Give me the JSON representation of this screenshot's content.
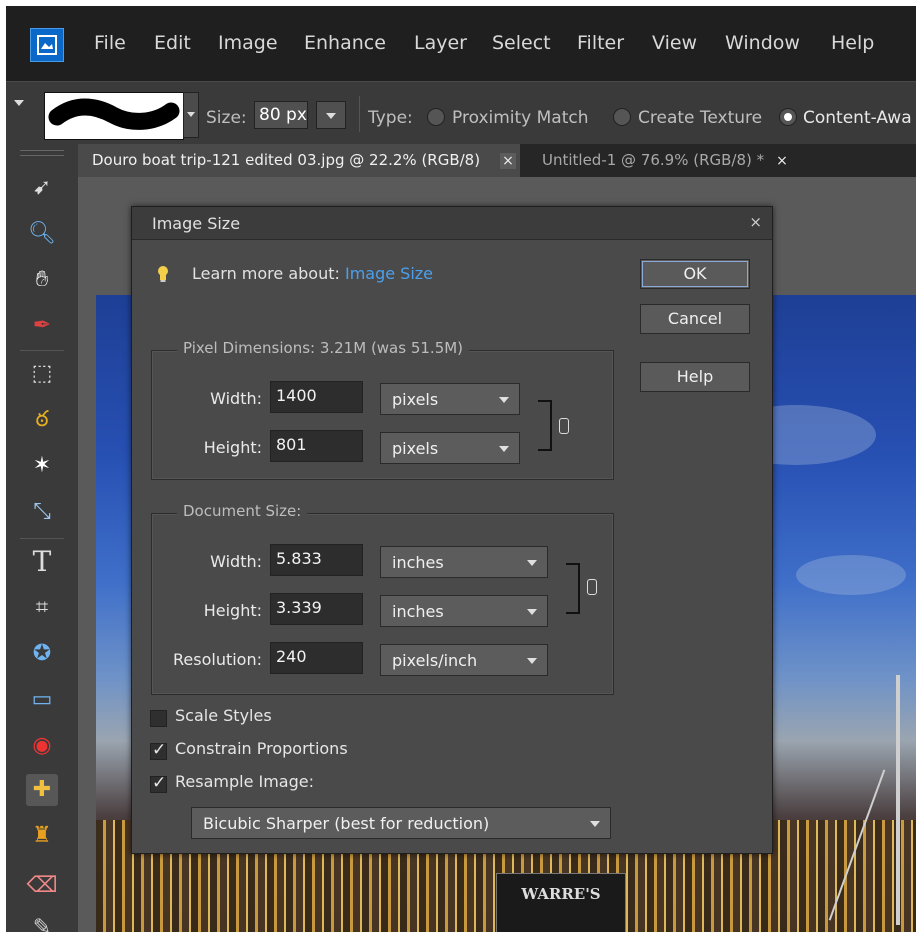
{
  "menu": [
    "File",
    "Edit",
    "Image",
    "Enhance",
    "Layer",
    "Select",
    "Filter",
    "View",
    "Window",
    "Help"
  ],
  "options": {
    "size_label": "Size:",
    "size_value": "80 px",
    "type_label": "Type:",
    "types": [
      "Proximity Match",
      "Create Texture",
      "Content-Awa"
    ],
    "selected_type": "Content-Awa"
  },
  "tabs": [
    {
      "label": "Douro boat trip-121 edited 03.jpg @ 22.2% (RGB/8)",
      "close": "×"
    },
    {
      "label": "Untitled-1 @ 76.9% (RGB/8) *",
      "close": "×"
    }
  ],
  "tools": [
    "move-tool",
    "zoom-tool",
    "hand-tool",
    "eyedropper-tool",
    "marquee-tool",
    "lasso-tool",
    "magic-wand-tool",
    "quick-selection-tool",
    "type-tool",
    "crop-tool",
    "cookie-cutter-tool",
    "straighten-tool",
    "red-eye-tool",
    "spot-healing-brush-tool",
    "clone-stamp-tool",
    "eraser-tool",
    "brush-tool"
  ],
  "photo": {
    "sign_text": "WARRE'S"
  },
  "dialog": {
    "title": "Image Size",
    "close": "×",
    "learn_prefix": "Learn more about:",
    "learn_link": "Image Size",
    "buttons": {
      "ok": "OK",
      "cancel": "Cancel",
      "help": "Help"
    },
    "pixel_dimensions": {
      "legend": "Pixel Dimensions:  3.21M (was 51.5M)",
      "width_label": "Width:",
      "width_value": "1400",
      "width_unit": "pixels",
      "height_label": "Height:",
      "height_value": "801",
      "height_unit": "pixels"
    },
    "document_size": {
      "legend": "Document Size:",
      "width_label": "Width:",
      "width_value": "5.833",
      "width_unit": "inches",
      "height_label": "Height:",
      "height_value": "3.339",
      "height_unit": "inches",
      "resolution_label": "Resolution:",
      "resolution_value": "240",
      "resolution_unit": "pixels/inch"
    },
    "checkboxes": [
      {
        "label": "Scale Styles",
        "checked": false
      },
      {
        "label": "Constrain Proportions",
        "checked": true
      },
      {
        "label": "Resample Image:",
        "checked": true
      }
    ],
    "resample_method": "Bicubic Sharper (best for reduction)"
  },
  "colors": {
    "link": "#4aa0ee",
    "accent": "#0a68c8"
  }
}
